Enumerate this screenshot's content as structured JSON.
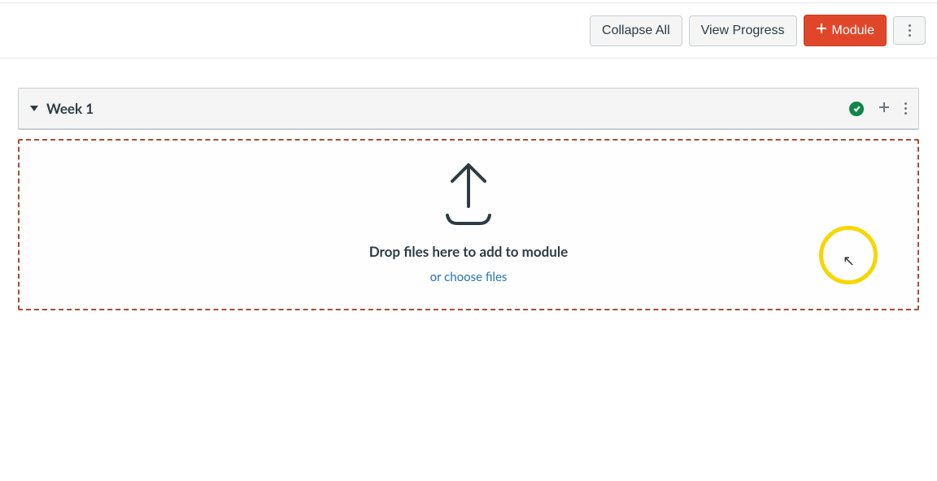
{
  "toolbar": {
    "collapse_label": "Collapse All",
    "progress_label": "View Progress",
    "module_label": "Module"
  },
  "module": {
    "title": "Week 1"
  },
  "dropzone": {
    "title": "Drop files here to add to module",
    "choose": "or choose files"
  }
}
